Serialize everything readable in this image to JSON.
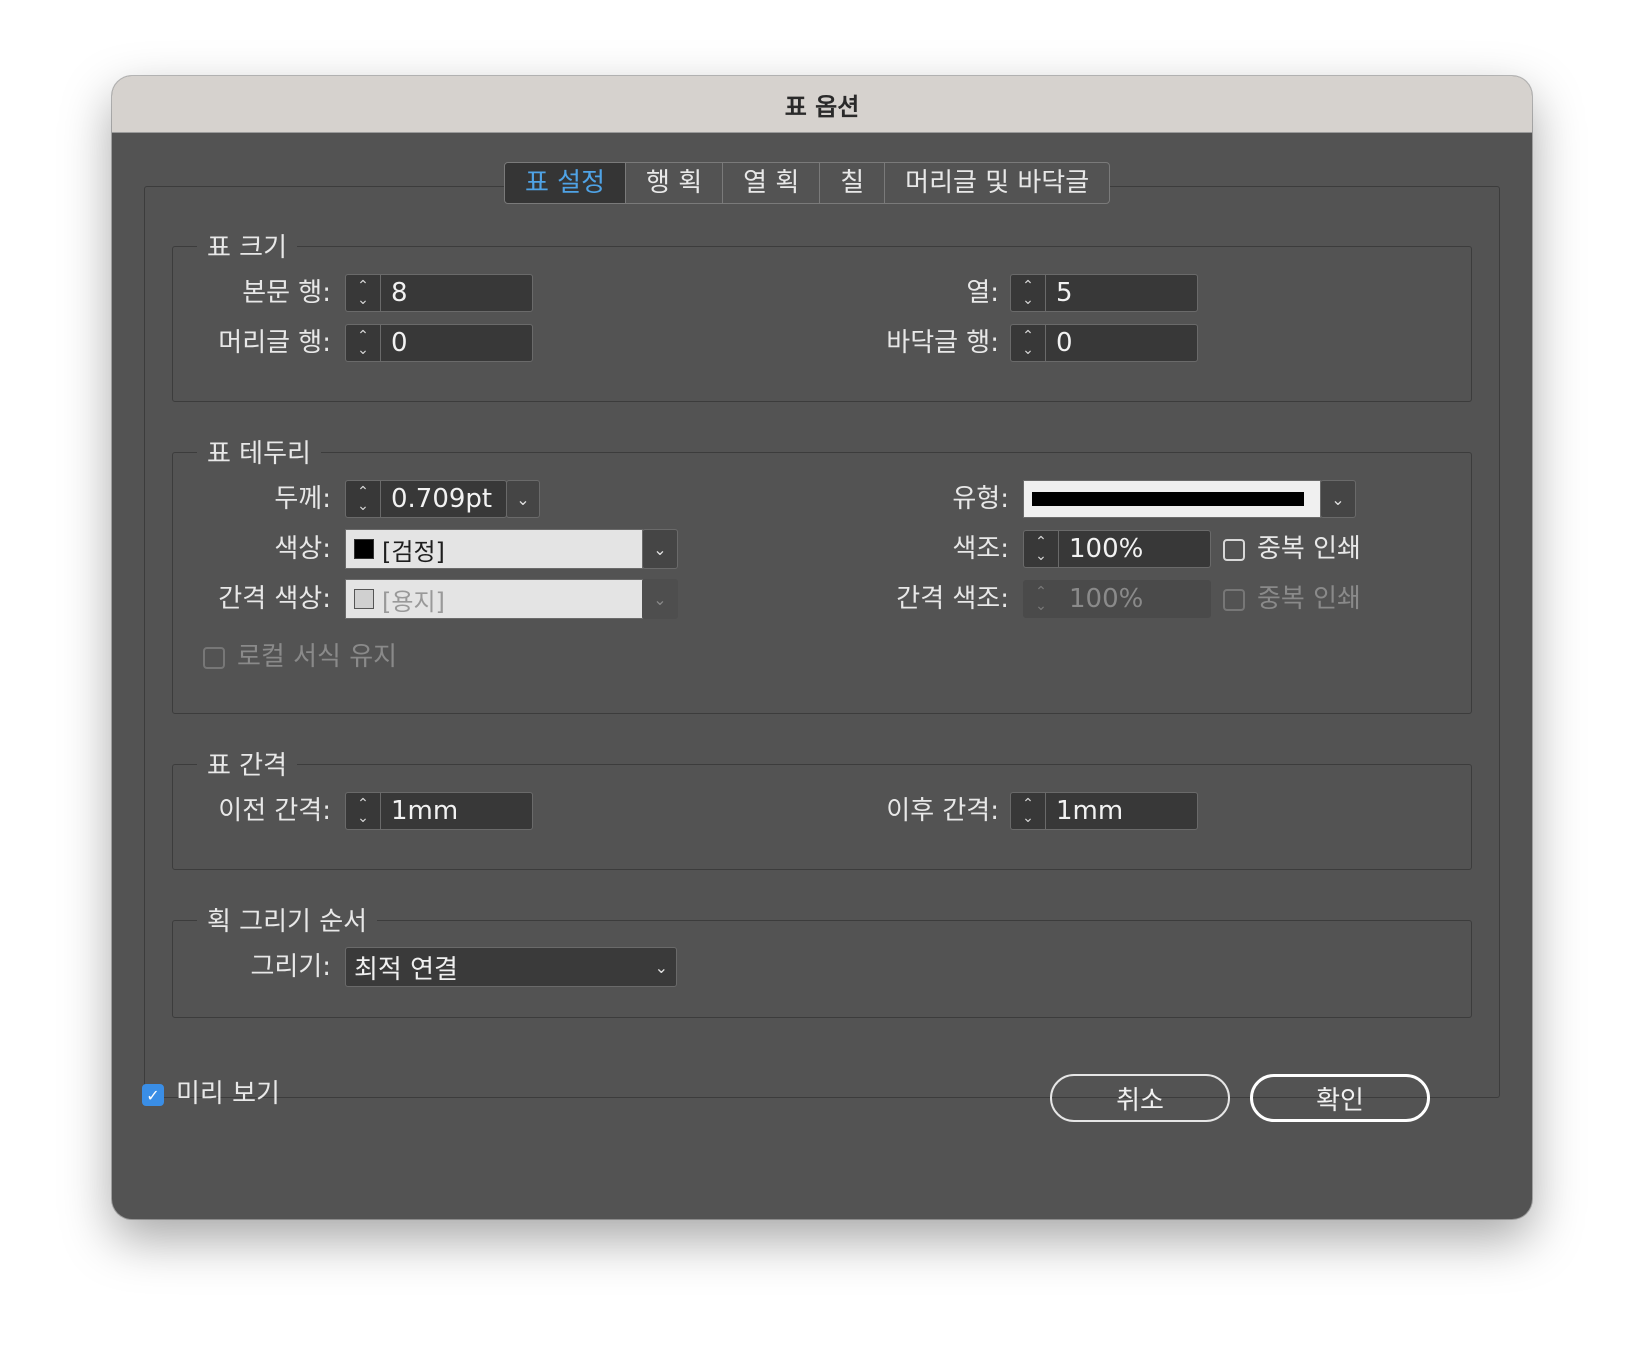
{
  "window": {
    "title": "표 옵션"
  },
  "tabs": [
    {
      "label": "표 설정",
      "active": true
    },
    {
      "label": "행 획",
      "active": false
    },
    {
      "label": "열 획",
      "active": false
    },
    {
      "label": "칠",
      "active": false
    },
    {
      "label": "머리글 및 바닥글",
      "active": false
    }
  ],
  "table_size": {
    "title": "표 크기",
    "body_rows": {
      "label": "본문 행:",
      "value": "8"
    },
    "header_rows": {
      "label": "머리글 행:",
      "value": "0"
    },
    "columns": {
      "label": "열:",
      "value": "5"
    },
    "footer_rows": {
      "label": "바닥글 행:",
      "value": "0"
    }
  },
  "table_border": {
    "title": "표 테두리",
    "weight": {
      "label": "두께:",
      "value": "0.709pt"
    },
    "type": {
      "label": "유형:"
    },
    "color": {
      "label": "색상:",
      "value": "[검정]",
      "swatch": "#000000"
    },
    "tint": {
      "label": "색조:",
      "value": "100%"
    },
    "overprint": {
      "label": "중복 인쇄",
      "checked": false
    },
    "gap_color": {
      "label": "간격 색상:",
      "value": "[용지]",
      "swatch": "#d8d8d8"
    },
    "gap_tint": {
      "label": "간격 색조:",
      "value": "100%"
    },
    "gap_overprint": {
      "label": "중복 인쇄",
      "checked": false
    },
    "preserve_local": {
      "label": "로컬 서식 유지",
      "checked": false
    }
  },
  "table_spacing": {
    "title": "표 간격",
    "before": {
      "label": "이전 간격:",
      "value": "1mm"
    },
    "after": {
      "label": "이후 간격:",
      "value": "1mm"
    }
  },
  "stroke_order": {
    "title": "획 그리기 순서",
    "draw": {
      "label": "그리기:",
      "value": "최적 연결"
    }
  },
  "footer": {
    "preview": {
      "label": "미리 보기",
      "checked": true
    },
    "cancel": "취소",
    "ok": "확인"
  },
  "colors": {
    "accent": "#3a8ee6",
    "active_tab_text": "#4fa3e6"
  }
}
